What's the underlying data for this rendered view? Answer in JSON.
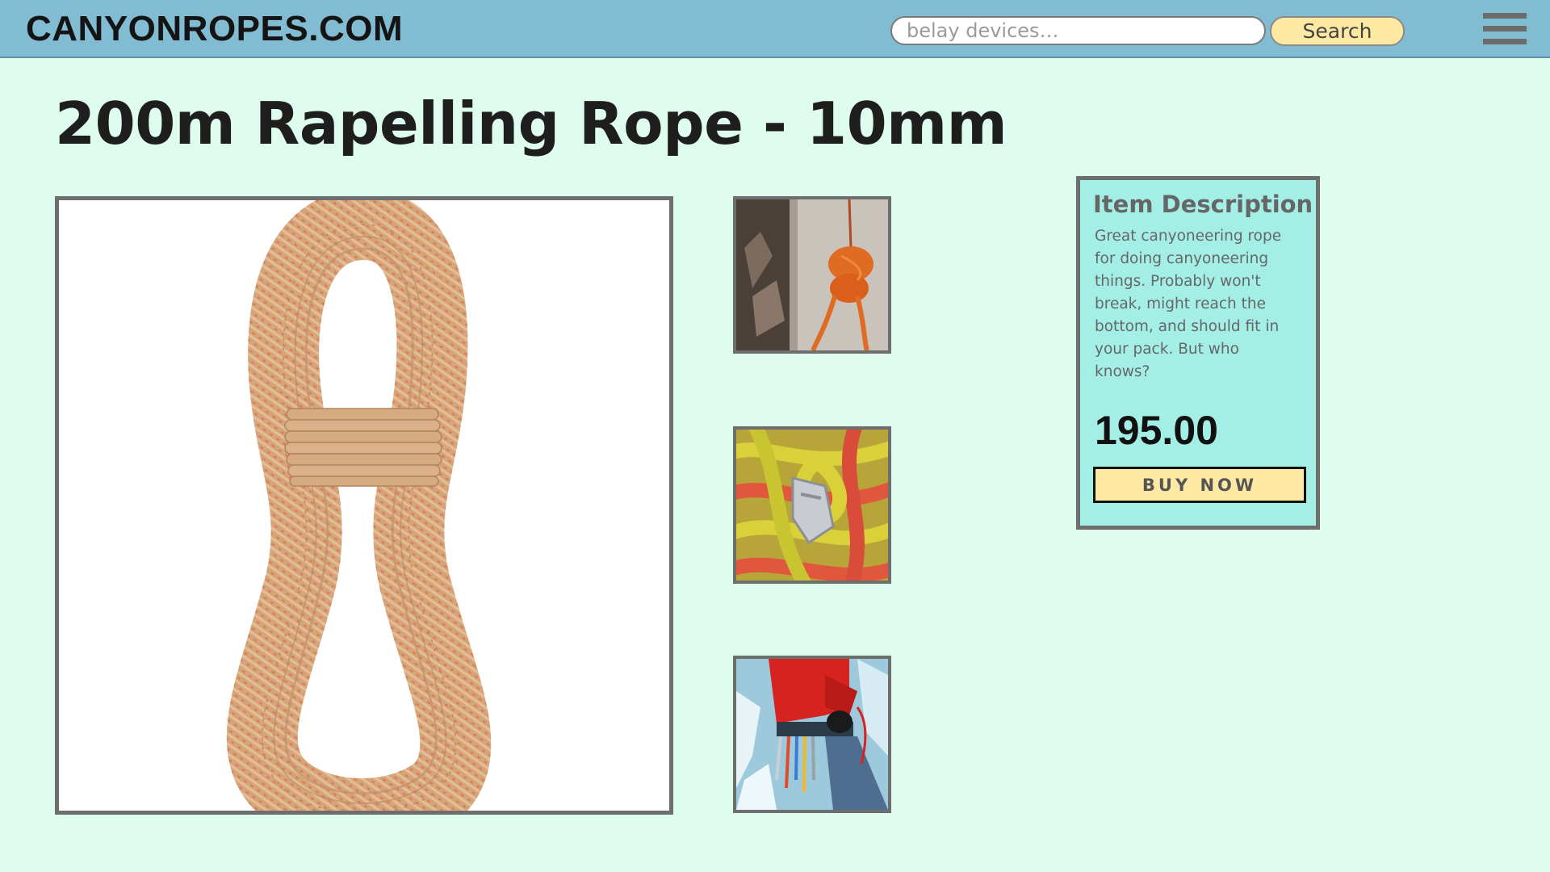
{
  "header": {
    "logo": "CANYONROPES.COM",
    "search": {
      "placeholder": "belay devices…",
      "button_label": "Search"
    },
    "menu_icon": "hamburger-menu-icon",
    "background_color": "#82bcd3"
  },
  "product": {
    "title": "200m Rapelling Rope - 10mm",
    "main_image": "coiled tan rope with orange flecks",
    "thumbnails": [
      "orange rope hanging on rock wall",
      "yellow and red ropes with belay device",
      "climber in red jacket with gear rack on ice"
    ]
  },
  "description_card": {
    "heading": "Item Description",
    "text": "Great canyoneering rope for doing canyoneering things. Probably won't break, might reach the bottom, and should fit in your pack. But who knows?",
    "price": "195.00",
    "buy_label": "BUY NOW",
    "background_color": "#a3efe6",
    "button_color": "#fde9a2"
  },
  "page_background": "#dffdee"
}
